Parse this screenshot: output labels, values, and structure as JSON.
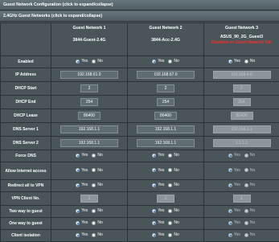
{
  "header": {
    "title": "Guest Network Configuration (click to expand/collapse)",
    "subtitle": "2.4GHz Guest Networks (click to expand/collapse)"
  },
  "columns": [
    {
      "title": "Guest Network 1",
      "ssid": "3844-Guest-2.4G",
      "warning": ""
    },
    {
      "title": "Guest Network 2",
      "ssid": "3844-Acc-2.4G",
      "warning": ""
    },
    {
      "title": "Guest Network 3",
      "ssid": "ASUS_90_2G_Guest3",
      "warning": "Disabled on Guest Network Tab"
    }
  ],
  "yes_label": "Yes",
  "no_label": "No",
  "rows": {
    "enabled": {
      "label": "Enabled",
      "values": [
        "yes",
        "yes",
        "yes"
      ]
    },
    "ip_address": {
      "label": "IP Address",
      "values": [
        "192.168.61.0",
        "192.168.67.0",
        "192.168.4.0"
      ]
    },
    "dhcp_start": {
      "label": "DHCP Start",
      "values": [
        "2",
        "2",
        "2"
      ]
    },
    "dhcp_end": {
      "label": "DHCP End",
      "values": [
        "254",
        "254",
        "254"
      ]
    },
    "dhcp_lease": {
      "label": "DHCP Lease",
      "values": [
        "86400",
        "86400",
        "86400"
      ]
    },
    "dns1": {
      "label": "DNS Server 1",
      "values": [
        "192.168.1.1",
        "192.168.1.1",
        "192.168.1.1"
      ]
    },
    "dns2": {
      "label": "DNS Server 2",
      "values": [
        "192.168.1.1",
        "192.168.1.1",
        "1.1.1.1"
      ]
    },
    "force_dns": {
      "label": "Force DNS",
      "values": [
        "yes",
        "yes",
        "yes"
      ]
    },
    "allow_internet": {
      "label": "Allow Internet access",
      "values": [
        "yes",
        "yes",
        "yes"
      ]
    },
    "redirect_vpn": {
      "label": "Redirect all to VPN",
      "values": [
        "yes",
        "yes",
        "yes"
      ]
    },
    "vpn_client": {
      "label": "VPN Client No.",
      "values": [
        "1",
        "1",
        "1"
      ]
    },
    "two_way": {
      "label": "Two way to guest",
      "values": [
        "yes",
        "yes",
        "yes"
      ]
    },
    "one_way": {
      "label": "One way to guest",
      "values": [
        "yes",
        "yes",
        "yes"
      ]
    },
    "isolation": {
      "label": "Client isolation",
      "values": [
        "yes",
        "yes",
        "yes"
      ]
    }
  },
  "colors": {
    "background": "#4a5559",
    "warning": "#ff2b2b",
    "header_bar": "#5a696d"
  }
}
